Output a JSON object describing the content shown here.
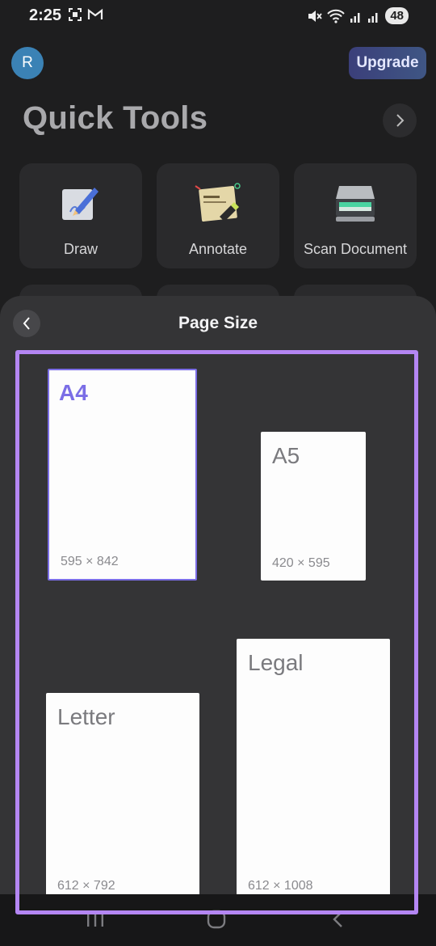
{
  "status_bar": {
    "time": "2:25",
    "battery": "48"
  },
  "header": {
    "avatar_initial": "R",
    "upgrade_label": "Upgrade"
  },
  "quick_tools": {
    "title": "Quick Tools",
    "tools": [
      {
        "label": "Draw",
        "icon": "draw-icon"
      },
      {
        "label": "Annotate",
        "icon": "annotate-icon"
      },
      {
        "label": "Scan Document",
        "icon": "scanner-icon"
      }
    ]
  },
  "sheet": {
    "title": "Page Size",
    "sizes": [
      {
        "name": "A4",
        "dims": "595 × 842",
        "selected": true
      },
      {
        "name": "A5",
        "dims": "420 × 595",
        "selected": false
      },
      {
        "name": "Letter",
        "dims": "612 × 792",
        "selected": false
      },
      {
        "name": "Legal",
        "dims": "612 × 1008",
        "selected": false
      }
    ]
  },
  "colors": {
    "accent": "#7b6ee6",
    "highlight": "#b486f3",
    "avatar": "#3b82b5"
  }
}
